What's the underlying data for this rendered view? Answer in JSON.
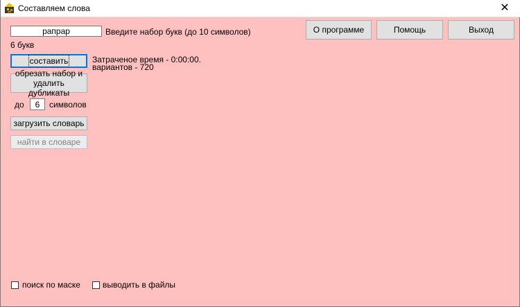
{
  "window": {
    "title": "Составляем слова",
    "close_glyph": "✕"
  },
  "input_letters": {
    "value": "рапрар",
    "hint": "Введите набор букв (до 10 символов)"
  },
  "letter_count": "6 букв",
  "buttons": {
    "compose": "составить",
    "trim": "обрезать набор и удалить дубликаты",
    "load_dict": "загрузить словарь",
    "find_dict": "найти в словаре",
    "about": "О программе",
    "help": "Помощь",
    "exit": "Выход"
  },
  "result": {
    "time": "Затраченое время - 0:00:00.",
    "variants": "вариантов - 720"
  },
  "length_limit": {
    "prefix": "до",
    "value": "6",
    "suffix": "символов"
  },
  "checkboxes": {
    "mask_search": "поиск по маске",
    "output_files": "выводить в файлы"
  },
  "colors": {
    "background": "#ffc0c0",
    "button": "#e1e1e1",
    "focus": "#0078d7"
  }
}
